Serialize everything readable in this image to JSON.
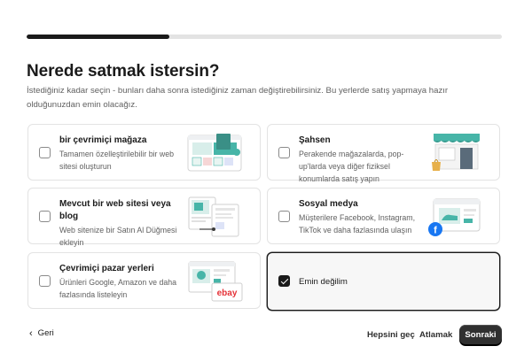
{
  "progress": {
    "percent": 30
  },
  "page": {
    "title": "Nerede satmak istersin?",
    "subtitle": "İstediğiniz kadar seçin - bunları daha sonra istediğiniz zaman değiştirebilirsiniz. Bu yerlerde satış yapmaya hazır olduğunuzdan emin olacağız."
  },
  "options": [
    {
      "title": "bir çevrimiçi mağaza",
      "desc": "Tamamen özelleştirilebilir bir web sitesi oluşturun",
      "checked": false
    },
    {
      "title": "Şahsen",
      "desc": "Perakende mağazalarda, pop-up'larda veya diğer fiziksel konumlarda satış yapın",
      "checked": false
    },
    {
      "title": "Mevcut bir web sitesi veya blog",
      "desc": "Web sitenize bir Satın Al Düğmesi ekleyin",
      "checked": false
    },
    {
      "title": "Sosyal medya",
      "desc": "Müşterilere Facebook, Instagram, TikTok ve daha fazlasında ulaşın",
      "checked": false
    },
    {
      "title": "Çevrimiçi pazar yerleri",
      "desc": "Ürünleri Google, Amazon ve daha fazlasında listeleyin",
      "checked": false
    },
    {
      "title": "Emin değilim",
      "desc": "",
      "checked": true
    }
  ],
  "illustrations": {
    "marketplace_logo": "ebay",
    "social_logo": "f"
  },
  "footer": {
    "back_label": "Geri",
    "skip_all_label": "Hepsini geç",
    "skip_label": "Atlamak",
    "next_label": "Sonraki"
  },
  "colors": {
    "primary": "#303030",
    "accent_teal": "#47b5a8",
    "border": "#e3e3e3"
  }
}
